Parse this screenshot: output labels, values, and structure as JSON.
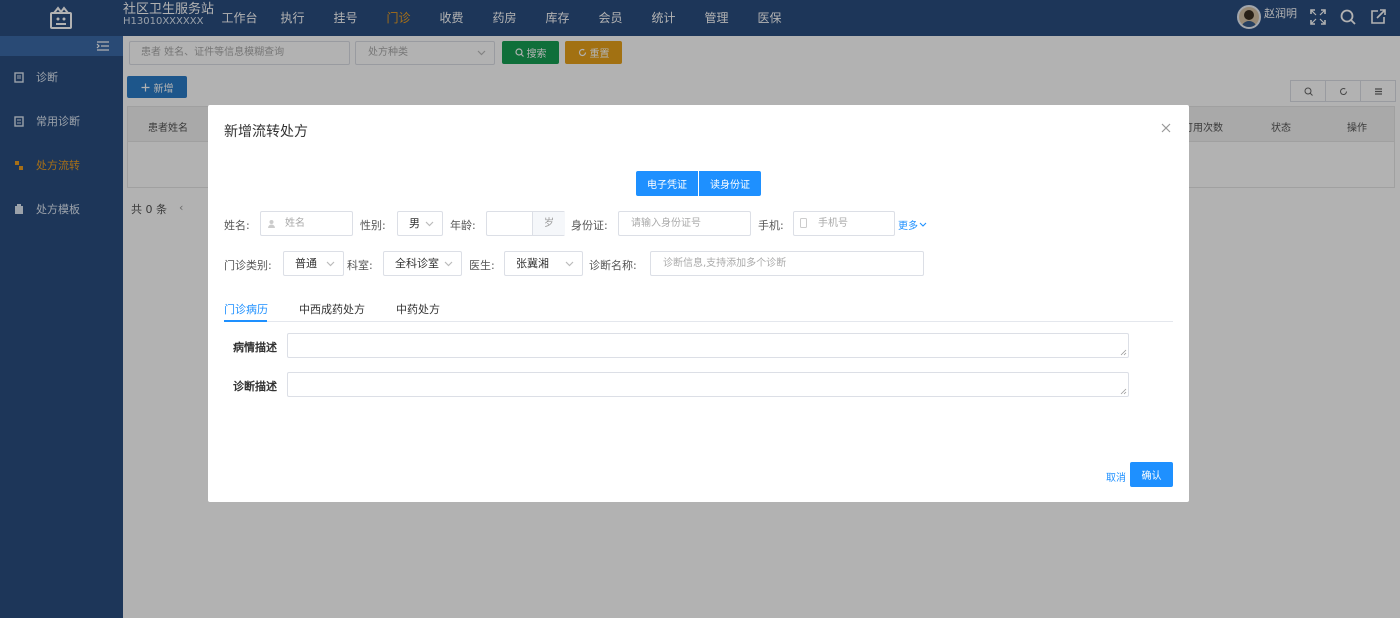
{
  "header": {
    "org_name": "社区卫生服务站",
    "org_code": "H13010XXXXXX",
    "nav": [
      "工作台",
      "执行",
      "挂号",
      "门诊",
      "收费",
      "药房",
      "库存",
      "会员",
      "统计",
      "管理",
      "医保"
    ],
    "active_nav": "门诊",
    "user_name": "赵润明"
  },
  "sidebar": {
    "items": [
      {
        "label": "诊断",
        "icon": "document-icon"
      },
      {
        "label": "常用诊断",
        "icon": "list-icon"
      },
      {
        "label": "处方流转",
        "icon": "transfer-icon"
      },
      {
        "label": "处方模板",
        "icon": "template-icon"
      }
    ],
    "active": "处方流转"
  },
  "toolbar": {
    "search_placeholder": "患者 姓名、证件等信息模糊查询",
    "type_placeholder": "处方种类",
    "search_label": "搜索",
    "reset_label": "重置",
    "add_label": "新增"
  },
  "table": {
    "columns": [
      "患者姓名",
      "可用次数",
      "状态",
      "操作"
    ],
    "total_text": "共 0 条"
  },
  "modal": {
    "title": "新增流转处方",
    "mode_buttons": [
      "电子凭证",
      "读身份证"
    ],
    "name_label": "姓名:",
    "name_placeholder": "姓名",
    "gender_label": "性别:",
    "gender_value": "男",
    "age_label": "年龄:",
    "age_suffix": "岁",
    "idcard_label": "身份证:",
    "idcard_placeholder": "请输入身份证号",
    "phone_label": "手机:",
    "phone_placeholder": "手机号",
    "more_label": "更多",
    "visit_type_label": "门诊类别:",
    "visit_type_value": "普通",
    "dept_label": "科室:",
    "dept_value": "全科诊室",
    "doctor_label": "医生:",
    "doctor_value": "张冀湘",
    "diag_label": "诊断名称:",
    "diag_placeholder": "诊断信息,支持添加多个诊断",
    "tabs": [
      "门诊病历",
      "中西成药处方",
      "中药处方"
    ],
    "active_tab": "门诊病历",
    "condition_label": "病情描述",
    "diagnosis_desc_label": "诊断描述",
    "cancel_label": "取消",
    "confirm_label": "确认"
  },
  "colors": {
    "header_bg": "#2a4e80",
    "accent": "#1e90ff",
    "active_nav": "#f0a020",
    "search_btn": "#16a054",
    "reset_btn": "#e8a21a",
    "add_btn": "#2a7cc7"
  }
}
